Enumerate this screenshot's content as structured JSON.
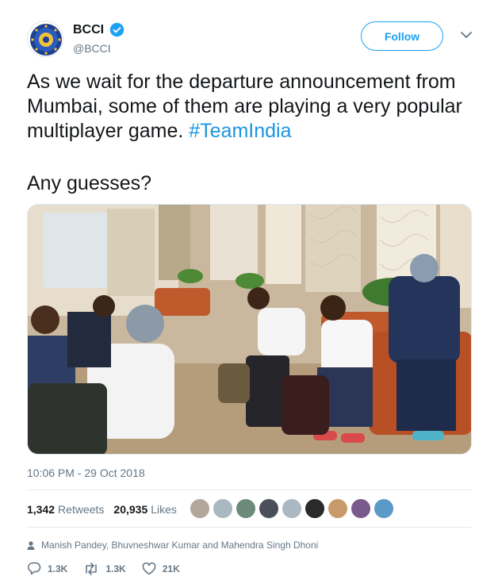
{
  "tweet": {
    "author": {
      "name": "BCCI",
      "handle": "@BCCI",
      "verified": true
    },
    "follow_label": "Follow",
    "text_main": "As we wait for the departure announcement from Mumbai, some of them are playing a very popular multiplayer game. ",
    "hashtag": "#TeamIndia",
    "text_second": "Any guesses?",
    "timestamp": "10:06 PM - 29 Oct 2018",
    "retweets_count": "1,342",
    "retweets_label": "Retweets",
    "likes_count": "20,935",
    "likes_label": "Likes",
    "tagged": "Manish Pandey, Bhuvneshwar Kumar and Mahendra Singh Dhoni",
    "actions": {
      "reply": "1.3K",
      "retweet": "1.3K",
      "like": "21K"
    }
  },
  "colors": {
    "link": "#1b95e0",
    "follow": "#1da1f2",
    "muted": "#657786"
  },
  "icons": [
    "verified-badge-icon",
    "caret-down-icon",
    "person-icon",
    "reply-icon",
    "retweet-icon",
    "heart-icon"
  ]
}
